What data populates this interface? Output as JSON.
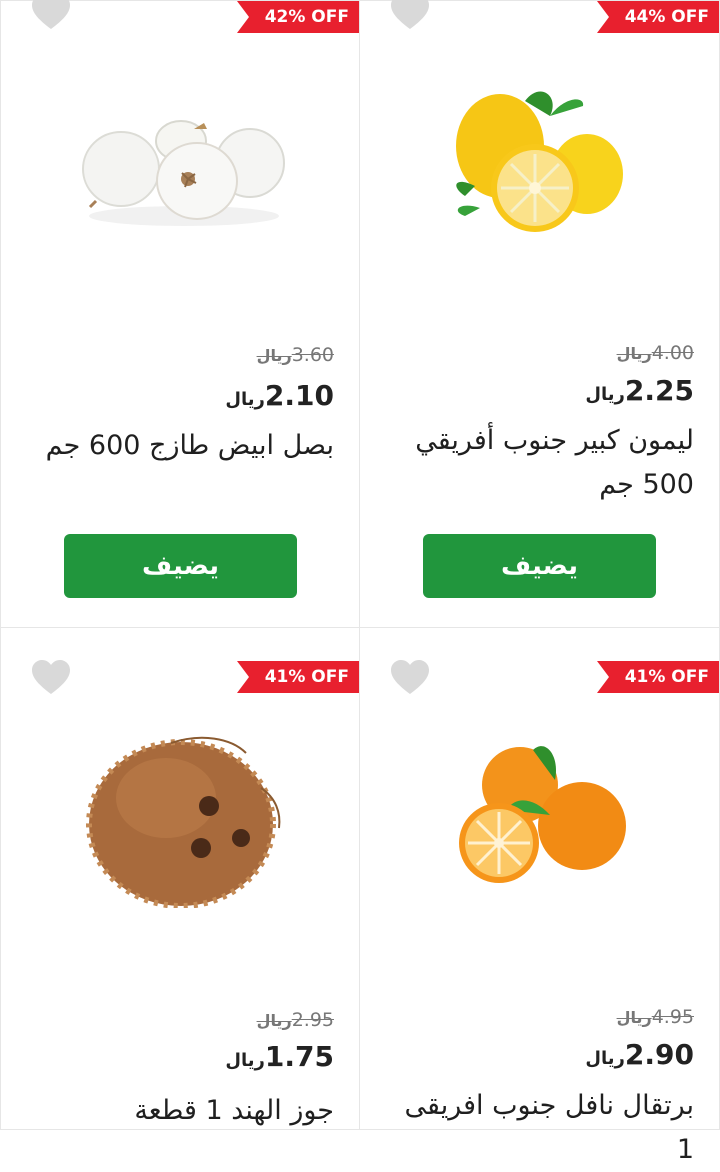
{
  "currency": "ريال",
  "add_label": "يضيف",
  "products": [
    {
      "discount": "42% OFF",
      "old_price": "3.60",
      "price": "2.10",
      "name": "بصل ابيض طازج 600 جم"
    },
    {
      "discount": "44% OFF",
      "old_price": "4.00",
      "price": "2.25",
      "name": "ليمون كبير جنوب أفريقي 500 جم"
    },
    {
      "discount": "41% OFF",
      "old_price": "2.95",
      "price": "1.75",
      "name": "جوز الهند 1 قطعة"
    },
    {
      "discount": "41% OFF",
      "old_price": "4.95",
      "price": "2.90",
      "name": "برتقال نافل جنوب افريقى 1"
    }
  ],
  "colors": {
    "badge": "#e8202e",
    "button": "#21963d",
    "heart": "#d9d9d9"
  }
}
